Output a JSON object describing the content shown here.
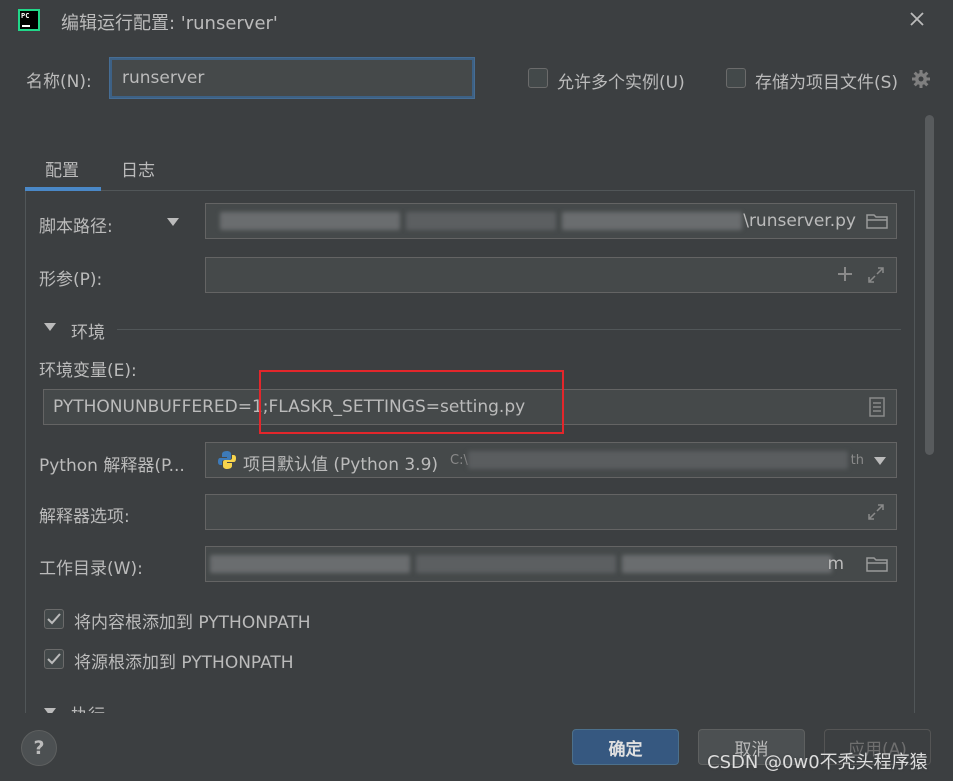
{
  "window": {
    "title": "编辑运行配置: 'runserver'",
    "app_icon_text": "PC"
  },
  "name_row": {
    "label": "名称(N):",
    "value": "runserver",
    "allow_multiple_label": "允许多个实例(U)",
    "store_as_project_label": "存储为项目文件(S)"
  },
  "tabs": [
    {
      "label": "配置",
      "active": true
    },
    {
      "label": "日志",
      "active": false
    }
  ],
  "form": {
    "script_path": {
      "label": "脚本路径:",
      "value": "\\runserver.py"
    },
    "params": {
      "label": "形参(P):",
      "value": ""
    },
    "env_section": {
      "label": "环境"
    },
    "env_vars": {
      "label": "环境变量(E):",
      "value": "PYTHONUNBUFFERED=1;FLASKR_SETTINGS=setting.py"
    },
    "interpreter": {
      "label": "Python 解释器(P...",
      "value": "项目默认值 (Python 3.9)",
      "path_prefix": "C:\\",
      "path_suffix": "th"
    },
    "interpreter_options": {
      "label": "解释器选项:",
      "value": ""
    },
    "working_dir": {
      "label": "工作目录(W):",
      "value": "m"
    },
    "add_content_roots": {
      "label": "将内容根添加到 PYTHONPATH",
      "checked": true
    },
    "add_source_roots": {
      "label": "将源根添加到 PYTHONPATH",
      "checked": true
    },
    "exec_section": {
      "label": "执行"
    }
  },
  "buttons": {
    "help": "?",
    "ok": "确定",
    "cancel": "取消",
    "apply": "应用(A)"
  },
  "watermark": "CSDN @0w0不秃头程序猿",
  "colors": {
    "background": "#3c3f41",
    "field_bg": "#45494a",
    "accent_blue": "#4a88c7",
    "highlight_red": "#e3262b",
    "ok_button": "#365880"
  }
}
